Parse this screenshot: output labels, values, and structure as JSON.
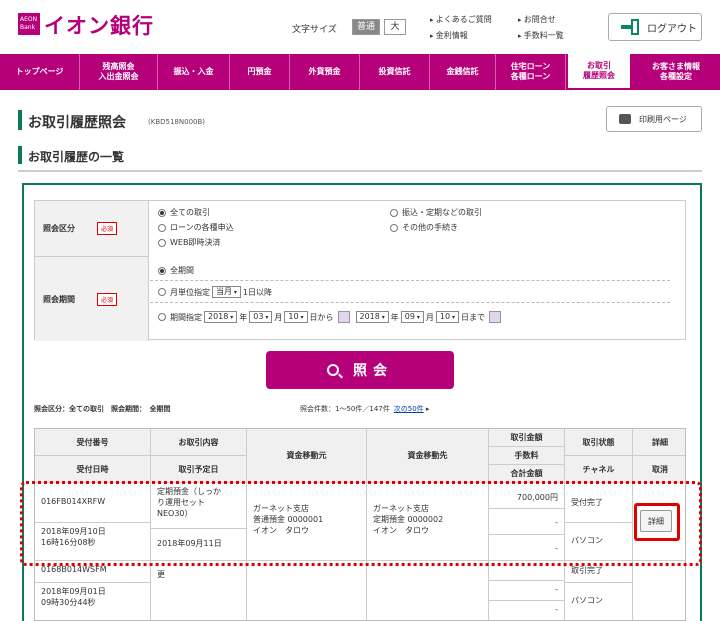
{
  "header": {
    "logo_small": "AEON Bank",
    "logo_text": "イオン銀行",
    "font_size_label": "文字サイズ",
    "font_normal": "普通",
    "font_large": "大",
    "links": [
      "よくあるご質問",
      "金利情報",
      "お問合せ",
      "手数料一覧"
    ],
    "logout": "ログアウト"
  },
  "nav": {
    "items": [
      {
        "label": "トップページ"
      },
      {
        "label": "残高照会\n入出金照会"
      },
      {
        "label": "振込・入金"
      },
      {
        "label": "円預金"
      },
      {
        "label": "外貨預金"
      },
      {
        "label": "投資信託"
      },
      {
        "label": "金銭信託"
      },
      {
        "label": "住宅ローン\n各種ローン"
      },
      {
        "label": "お取引\n履歴照会"
      },
      {
        "label": "お客さま情報\n各種設定"
      }
    ]
  },
  "page": {
    "title": "お取引履歴照会",
    "code": "(KBD518N000B)",
    "print_label": "印刷用ページ",
    "section_title": "お取引履歴の一覧"
  },
  "form": {
    "category_label": "照会区分",
    "period_label": "照会期間",
    "required": "必須",
    "category_options": [
      "全ての取引",
      "振込・定期などの取引",
      "ローンの各種申込",
      "その他の手続き",
      "WEB即時決済"
    ],
    "period_all": "全期間",
    "monthly_prefix": "月単位指定",
    "monthly_value": "当月",
    "monthly_suffix": "1日以降",
    "range_prefix": "期間指定",
    "from_year": "2018",
    "from_month": "03",
    "from_day": "10",
    "to_year": "2018",
    "to_month": "09",
    "to_day": "10",
    "year_unit": "年",
    "month_unit": "月",
    "day_unit_from": "日から",
    "day_unit_to": "日まで",
    "search_label": "照会"
  },
  "summary": {
    "condition": "照会区分：全ての取引　照会期間：　全期間",
    "count": "照会件数：1～50件／147件",
    "next": "次の50件"
  },
  "table": {
    "headers": {
      "receipt_no": "受付番号",
      "receipt_date": "受付日時",
      "content": "お取引内容",
      "scheduled": "取引予定日",
      "from": "資金移動元",
      "to": "資金移動先",
      "amount": "取引金額",
      "fee": "手数料",
      "total": "合計金額",
      "status": "取引状態",
      "channel": "チャネル",
      "detail": "詳細",
      "cancel": "取消"
    },
    "rows": [
      {
        "receipt_no": "016FB014XRFW",
        "receipt_date": "2018年09月10日\n16時16分08秒",
        "content": "定期預金（しっか\nり運用セット\nNEO30）",
        "scheduled": "2018年09月11日",
        "from": "ガーネット支店\n普通預金 0000001\nイオン　タロウ",
        "to": "ガーネット支店\n定期預金 0000002\nイオン　タロウ",
        "amount": "700,000円",
        "fee": "-",
        "total": "-",
        "status": "受付完了",
        "channel": "パソコン",
        "detail": "詳細"
      },
      {
        "receipt_no": "0168B014WSFM",
        "receipt_date": "2018年09月01日\n09時30分44秒",
        "content": "更",
        "status": "取引完了",
        "channel": "パソコン",
        "fee": "-",
        "total": "-"
      }
    ]
  },
  "colors": {
    "brand": "#b6007a",
    "accent_green": "#0a7a5a",
    "highlight": "#e00000"
  }
}
